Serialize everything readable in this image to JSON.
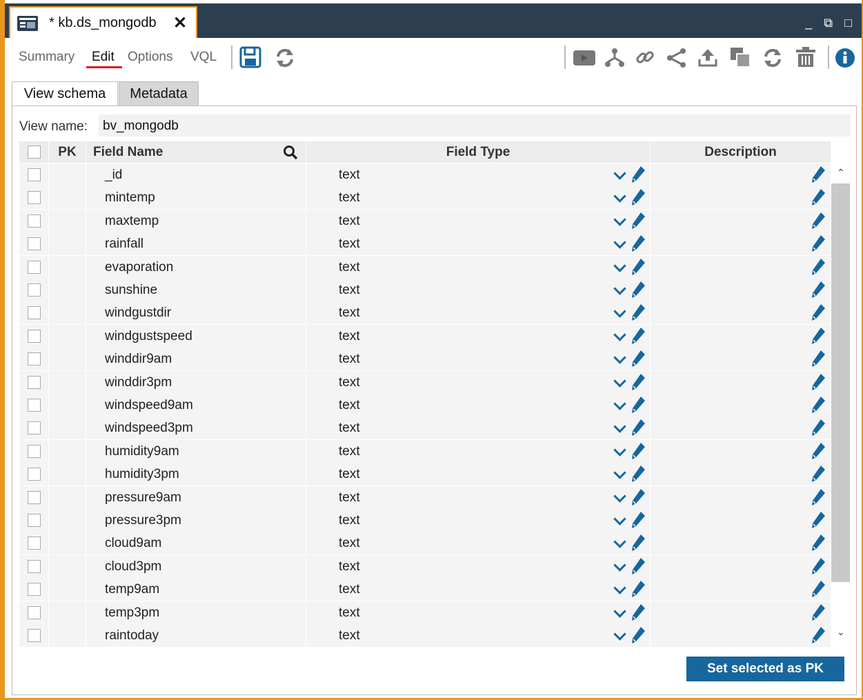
{
  "window": {
    "tab_title": "* kb.ds_mongodb",
    "close_glyph": "✕",
    "controls": {
      "minimize": "_",
      "restore": "⧉",
      "maximize": "□"
    }
  },
  "menu_tabs": [
    {
      "label": "Summary",
      "active": false
    },
    {
      "label": "Edit",
      "active": true
    },
    {
      "label": "Options",
      "active": false
    },
    {
      "label": "VQL",
      "active": false
    }
  ],
  "toolbar_icons": [
    "save-icon",
    "refresh-icon",
    "video-icon",
    "tree-icon",
    "link-icon",
    "share-icon",
    "upload-icon",
    "copy-icon",
    "reload-icon",
    "trash-icon",
    "info-icon"
  ],
  "view_tabs": [
    {
      "label": "View schema",
      "active": true
    },
    {
      "label": "Metadata",
      "active": false
    }
  ],
  "view_name": {
    "label": "View name:",
    "value": "bv_mongodb"
  },
  "columns": {
    "pk": "PK",
    "field_name": "Field Name",
    "field_type": "Field Type",
    "description": "Description"
  },
  "rows": [
    {
      "name": "_id",
      "type": "text"
    },
    {
      "name": "mintemp",
      "type": "text"
    },
    {
      "name": "maxtemp",
      "type": "text"
    },
    {
      "name": "rainfall",
      "type": "text"
    },
    {
      "name": "evaporation",
      "type": "text"
    },
    {
      "name": "sunshine",
      "type": "text"
    },
    {
      "name": "windgustdir",
      "type": "text"
    },
    {
      "name": "windgustspeed",
      "type": "text"
    },
    {
      "name": "winddir9am",
      "type": "text"
    },
    {
      "name": "winddir3pm",
      "type": "text"
    },
    {
      "name": "windspeed9am",
      "type": "text"
    },
    {
      "name": "windspeed3pm",
      "type": "text"
    },
    {
      "name": "humidity9am",
      "type": "text"
    },
    {
      "name": "humidity3pm",
      "type": "text"
    },
    {
      "name": "pressure9am",
      "type": "text"
    },
    {
      "name": "pressure3pm",
      "type": "text"
    },
    {
      "name": "cloud9am",
      "type": "text"
    },
    {
      "name": "cloud3pm",
      "type": "text"
    },
    {
      "name": "temp9am",
      "type": "text"
    },
    {
      "name": "temp3pm",
      "type": "text"
    },
    {
      "name": "raintoday",
      "type": "text"
    }
  ],
  "buttons": {
    "set_pk": "Set selected as PK"
  },
  "colors": {
    "accent": "#e8961e",
    "titlebar": "#2d3e50",
    "primary": "#17669d",
    "active_underline": "#d9211c"
  }
}
